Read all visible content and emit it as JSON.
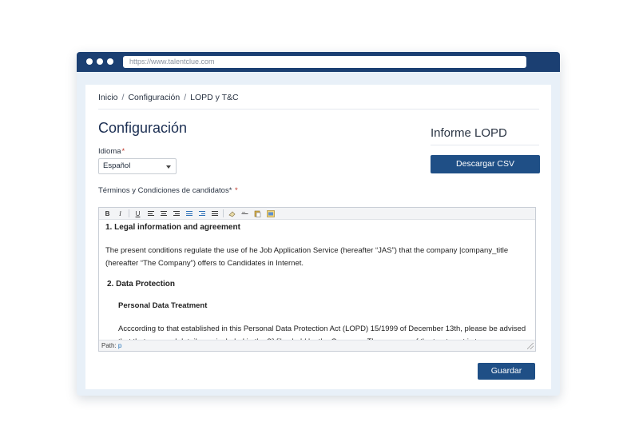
{
  "browser": {
    "url": "https://www.talentclue.com"
  },
  "breadcrumb": {
    "items": [
      "Inicio",
      "Configuración",
      "LOPD y T&C"
    ],
    "separator": "/"
  },
  "page": {
    "title": "Configuración"
  },
  "idioma": {
    "label": "Idioma",
    "required_mark": "*",
    "selected": "Español"
  },
  "terms": {
    "label": "Términos y Condiciones de candidatos*",
    "required_mark": "*"
  },
  "informe": {
    "title": "Informe LOPD",
    "button_label": "Descargar CSV"
  },
  "editor": {
    "toolbar": [
      "bold-icon",
      "italic-icon",
      "underline-icon",
      "align-left-icon",
      "align-center-icon",
      "align-right-icon",
      "justify-icon",
      "indent-icon",
      "bullet-list-icon",
      "numbered-list-icon",
      "eraser-icon",
      "horizontal-rule-icon",
      "paste-icon",
      "image-icon"
    ],
    "content": {
      "heading1": "1. Legal information and agreement",
      "para1": "The present conditions regulate the use of he Job Application Service (hereafter “JAS”) that the company |company_title (hereafter “The Company”) offers to Candidates in Internet.",
      "heading2": "2. Data Protection",
      "heading3": "Personal Data Treatment",
      "para2": "Acccording to that established in this Personal Data Protection Act (LOPD) 15/1999 of December 13th, please be advised that that personal details are included in the 3ª files held by the Company. The purpose of the treatment is to process your"
    },
    "path_label": "Path:",
    "path_value": "p"
  },
  "actions": {
    "save_label": "Guardar"
  },
  "colors": {
    "titlebar": "#1b3f72",
    "primary_button": "#1f4f86",
    "required": "#c0392b"
  }
}
